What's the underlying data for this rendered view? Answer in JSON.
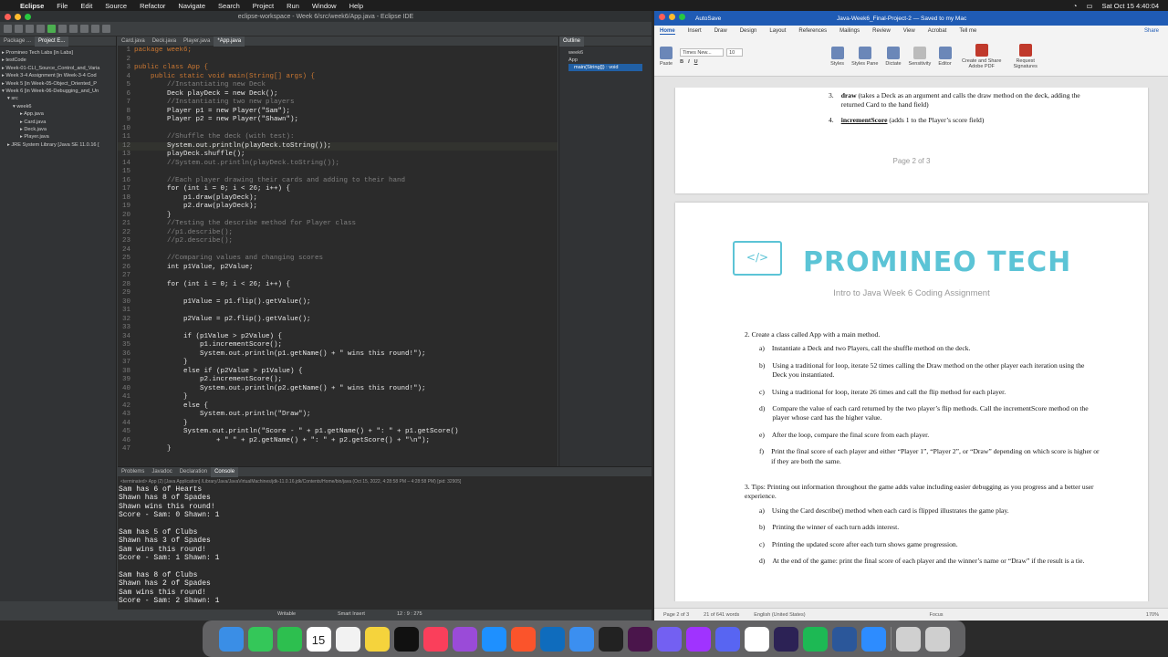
{
  "menubar": {
    "apple": "",
    "app": "Eclipse",
    "items": [
      "File",
      "Edit",
      "Source",
      "Refactor",
      "Navigate",
      "Search",
      "Project",
      "Run",
      "Window",
      "Help"
    ],
    "datetime": "Sat Oct 15 4:40:04"
  },
  "eclipse": {
    "title": "eclipse-workspace - Week 6/src/week6/App.java - Eclipse IDE",
    "left_tabs": [
      "Package ...",
      "Project E..."
    ],
    "editor_tabs": [
      "Card.java",
      "Deck.java",
      "Player.java",
      "*App.java"
    ],
    "outline_tab": "Outline",
    "tree": [
      "Promineo Tech Labs [in Labs]",
      "testCode",
      "Week-01-CLI_Source_Control_and_Varia",
      "Week 3-4 Assignment [in Week-3-4 Cod",
      "Week 5 [in Week-05-Object_Oriented_P",
      "Week 6 [in Week-06-Debugging_and_Un",
      "src",
      "week6",
      "App.java",
      "Card.java",
      "Deck.java",
      "Player.java",
      "JRE System Library [Java SE 11.0.16 ["
    ],
    "outline_items": [
      "week6",
      "App",
      "main(String[]) : void"
    ],
    "code_lines": [
      {
        "n": "1",
        "t": "package week6;",
        "c": "kw"
      },
      {
        "n": "2",
        "t": "",
        "c": ""
      },
      {
        "n": "3",
        "t": "public class App {",
        "c": "kw"
      },
      {
        "n": "4",
        "t": "    public static void main(String[] args) {",
        "c": "kw"
      },
      {
        "n": "5",
        "t": "        //Instantiating new Deck",
        "c": "cm"
      },
      {
        "n": "6",
        "t": "        Deck playDeck = new Deck();",
        "c": ""
      },
      {
        "n": "7",
        "t": "        //Instantiating two new players",
        "c": "cm"
      },
      {
        "n": "8",
        "t": "        Player p1 = new Player(\"Sam\");",
        "c": ""
      },
      {
        "n": "9",
        "t": "        Player p2 = new Player(\"Shawn\");",
        "c": ""
      },
      {
        "n": "10",
        "t": "",
        "c": ""
      },
      {
        "n": "11",
        "t": "        //Shuffle the deck (with test):",
        "c": "cm"
      },
      {
        "n": "12",
        "t": "        System.out.println(playDeck.toString());",
        "c": "hl"
      },
      {
        "n": "13",
        "t": "        playDeck.shuffle();",
        "c": ""
      },
      {
        "n": "14",
        "t": "        //System.out.println(playDeck.toString());",
        "c": "cm"
      },
      {
        "n": "15",
        "t": "",
        "c": ""
      },
      {
        "n": "16",
        "t": "        //Each player drawing their cards and adding to their hand",
        "c": "cm"
      },
      {
        "n": "17",
        "t": "        for (int i = 0; i < 26; i++) {",
        "c": ""
      },
      {
        "n": "18",
        "t": "            p1.draw(playDeck);",
        "c": ""
      },
      {
        "n": "19",
        "t": "            p2.draw(playDeck);",
        "c": ""
      },
      {
        "n": "20",
        "t": "        }",
        "c": ""
      },
      {
        "n": "21",
        "t": "        //Testing the describe method for Player class",
        "c": "cm"
      },
      {
        "n": "22",
        "t": "        //p1.describe();",
        "c": "cm"
      },
      {
        "n": "23",
        "t": "        //p2.describe();",
        "c": "cm"
      },
      {
        "n": "24",
        "t": "",
        "c": ""
      },
      {
        "n": "25",
        "t": "        //Comparing values and changing scores",
        "c": "cm"
      },
      {
        "n": "26",
        "t": "        int p1Value, p2Value;",
        "c": ""
      },
      {
        "n": "27",
        "t": "",
        "c": ""
      },
      {
        "n": "28",
        "t": "        for (int i = 0; i < 26; i++) {",
        "c": ""
      },
      {
        "n": "29",
        "t": "",
        "c": ""
      },
      {
        "n": "30",
        "t": "            p1Value = p1.flip().getValue();",
        "c": ""
      },
      {
        "n": "31",
        "t": "",
        "c": ""
      },
      {
        "n": "32",
        "t": "            p2Value = p2.flip().getValue();",
        "c": ""
      },
      {
        "n": "33",
        "t": "",
        "c": ""
      },
      {
        "n": "34",
        "t": "            if (p1Value > p2Value) {",
        "c": ""
      },
      {
        "n": "35",
        "t": "                p1.incrementScore();",
        "c": ""
      },
      {
        "n": "36",
        "t": "                System.out.println(p1.getName() + \" wins this round!\");",
        "c": ""
      },
      {
        "n": "37",
        "t": "            }",
        "c": ""
      },
      {
        "n": "38",
        "t": "            else if (p2Value > p1Value) {",
        "c": ""
      },
      {
        "n": "39",
        "t": "                p2.incrementScore();",
        "c": ""
      },
      {
        "n": "40",
        "t": "                System.out.println(p2.getName() + \" wins this round!\");",
        "c": ""
      },
      {
        "n": "41",
        "t": "            }",
        "c": ""
      },
      {
        "n": "42",
        "t": "            else {",
        "c": ""
      },
      {
        "n": "43",
        "t": "                System.out.println(\"Draw\");",
        "c": ""
      },
      {
        "n": "44",
        "t": "            }",
        "c": ""
      },
      {
        "n": "45",
        "t": "            System.out.println(\"Score - \" + p1.getName() + \": \" + p1.getScore()",
        "c": ""
      },
      {
        "n": "46",
        "t": "                    + \" \" + p2.getName() + \": \" + p2.getScore() + \"\\n\");",
        "c": ""
      },
      {
        "n": "47",
        "t": "        }",
        "c": ""
      }
    ],
    "console_tabs": [
      "Problems",
      "Javadoc",
      "Declaration",
      "Console"
    ],
    "console_info": "<terminated> App (2) [Java Application] /Library/Java/JavaVirtualMachines/jdk-11.0.16.jdk/Contents/Home/bin/java  (Oct 15, 2022, 4:28:58 PM – 4:28:58 PM) [pid: 32905]",
    "console_output": "Sam has 6 of Hearts\nShawn has 8 of Spades\nShawn wins this round!\nScore - Sam: 0 Shawn: 1\n\nSam has 5 of Clubs\nShawn has 3 of Spades\nSam wins this round!\nScore - Sam: 1 Shawn: 1\n\nSam has 8 of Clubs\nShawn has 2 of Spades\nSam wins this round!\nScore - Sam: 2 Shawn: 1",
    "status": {
      "writable": "Writable",
      "insert": "Smart Insert",
      "position": "12 : 9 : 275"
    }
  },
  "word": {
    "autosave": "AutoSave",
    "doc_title": "Java-Week6_Final-Project-2 — Saved to my Mac",
    "tabs": [
      "Home",
      "Insert",
      "Draw",
      "Design",
      "Layout",
      "References",
      "Mailings",
      "Review",
      "View",
      "Acrobat",
      "Tell me"
    ],
    "share": "Share",
    "font": "Times New...",
    "size": "10",
    "ribbon_labels": [
      "Paste",
      "Styles",
      "Styles Pane",
      "Dictate",
      "Sensitivity",
      "Editor",
      "Create and Share Adobe PDF",
      "Request Signatures"
    ],
    "page2_items": [
      {
        "num": "3.",
        "bold": "draw",
        "rest": " (takes a Deck as an argument and calls the draw method on the deck, adding the returned Card to the hand field)"
      },
      {
        "num": "4.",
        "bold": "incrementScore",
        "rest": " (adds 1 to the Player’s score field)"
      }
    ],
    "page_label": "Page 2 of 3",
    "logo_text": "PROMINEO TECH",
    "subtitle": "Intro to Java Week 6 Coding Assignment",
    "section2": "2.   Create a class called App with a main method.",
    "section2_items": [
      {
        "l": "a)",
        "t": "Instantiate a Deck and two Players, call the shuffle method on the deck."
      },
      {
        "l": "b)",
        "t": "Using a traditional for loop, iterate 52 times calling the Draw method on the other player each iteration using the Deck you instantiated."
      },
      {
        "l": "c)",
        "t": "Using a traditional for loop, iterate 26 times and call the flip method for each player."
      },
      {
        "l": "d)",
        "t": "Compare the value of each card returned by the two player’s flip methods. Call the incrementScore method on the player whose card has the higher value."
      },
      {
        "l": "e)",
        "t": "After the loop, compare the final score from each player."
      },
      {
        "l": "f)",
        "t": "Print the final score of each player and either “Player 1”, “Player 2”, or “Draw” depending on which score is higher or if they are both the same."
      }
    ],
    "section3": "3.   Tips:  Printing out information throughout the game adds value including easier debugging as you progress and a better user experience.",
    "section3_items": [
      {
        "l": "a)",
        "t": "Using the Card describe() method when each card is flipped illustrates the game play."
      },
      {
        "l": "b)",
        "t": "Printing the winner of each turn adds interest."
      },
      {
        "l": "c)",
        "t": "Printing the updated score after each turn shows game progression."
      },
      {
        "l": "d)",
        "t": "At the end of the game: print the final score of each player and the winner’s name or “Draw” if the result is a tie."
      }
    ],
    "status": {
      "page": "Page 2 of 3",
      "words": "21 of 641 words",
      "lang": "English (United States)",
      "focus": "Focus",
      "zoom": "170%"
    }
  },
  "dock_apps": [
    "finder-icon",
    "messages-icon",
    "facetime-icon",
    "calendar-icon",
    "reminders-icon",
    "notes-icon",
    "appletv-icon",
    "music-icon",
    "podcasts-icon",
    "safari-icon",
    "brave-icon",
    "outlook-icon",
    "mail-icon",
    "terminal-icon",
    "slack-icon",
    "viber-icon",
    "messenger-icon",
    "discord-icon",
    "chrome-icon",
    "eclipse-icon",
    "spotify-icon",
    "word-icon",
    "zoom-icon",
    "downloads-icon",
    "trash-icon"
  ],
  "calendar_day": "15",
  "colors": {
    "accent": "#1f5bb4",
    "logo": "#5cc4d6"
  }
}
